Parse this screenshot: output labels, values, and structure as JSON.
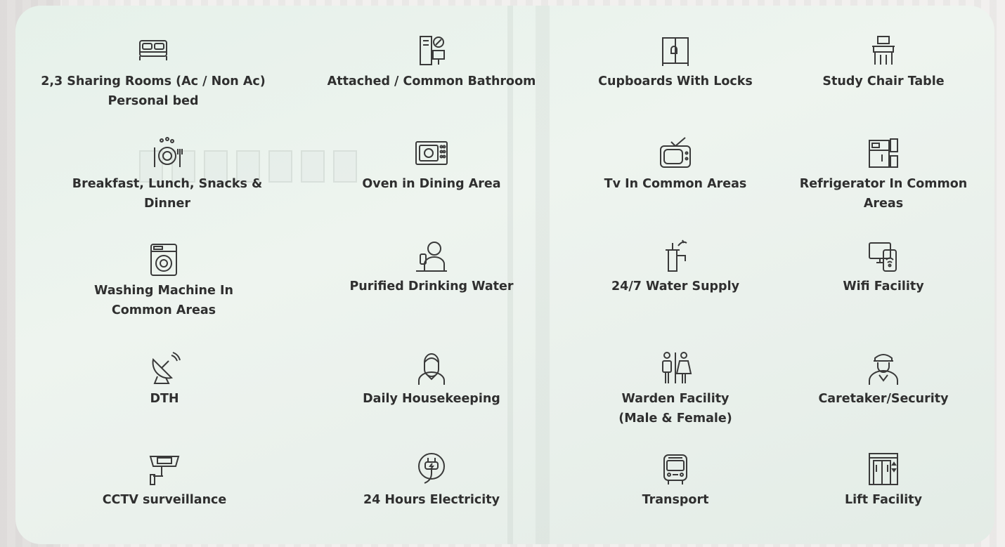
{
  "amenities": [
    {
      "label": "2,3 Sharing Rooms (Ac / Non Ac)\nPersonal bed",
      "icon": "bed-icon"
    },
    {
      "label": "Attached / Common Bathroom",
      "icon": "bathroom-icon"
    },
    {
      "label": "Cupboards With Locks",
      "icon": "cupboard-icon"
    },
    {
      "label": "Study Chair Table",
      "icon": "study-table-icon"
    },
    {
      "label": "Breakfast, Lunch, Snacks &\nDinner",
      "icon": "meal-icon"
    },
    {
      "label": "Oven in Dining Area",
      "icon": "oven-icon"
    },
    {
      "label": "Tv In Common Areas",
      "icon": "tv-icon"
    },
    {
      "label": "Refrigerator In Common\nAreas",
      "icon": "refrigerator-icon"
    },
    {
      "label": "Washing Machine In\nCommon Areas",
      "icon": "washing-machine-icon"
    },
    {
      "label": "Purified Drinking Water",
      "icon": "drinking-water-icon"
    },
    {
      "label": "24/7 Water Supply",
      "icon": "water-tap-icon"
    },
    {
      "label": "Wifi Facility",
      "icon": "wifi-device-icon"
    },
    {
      "label": "DTH",
      "icon": "satellite-dish-icon"
    },
    {
      "label": "Daily Housekeeping",
      "icon": "housekeeper-icon"
    },
    {
      "label": "Warden Facility\n(Male & Female)",
      "icon": "male-female-icon"
    },
    {
      "label": "Caretaker/Security",
      "icon": "security-guard-icon"
    },
    {
      "label": "CCTV surveillance",
      "icon": "cctv-camera-icon"
    },
    {
      "label": "24 Hours Electricity",
      "icon": "electric-plug-icon"
    },
    {
      "label": "Transport",
      "icon": "bus-icon"
    },
    {
      "label": "Lift Facility",
      "icon": "elevator-icon"
    }
  ],
  "colors": {
    "panel": "#e6f1ea",
    "text": "#2f2f2f",
    "icon_stroke": "#3a3a3a"
  }
}
